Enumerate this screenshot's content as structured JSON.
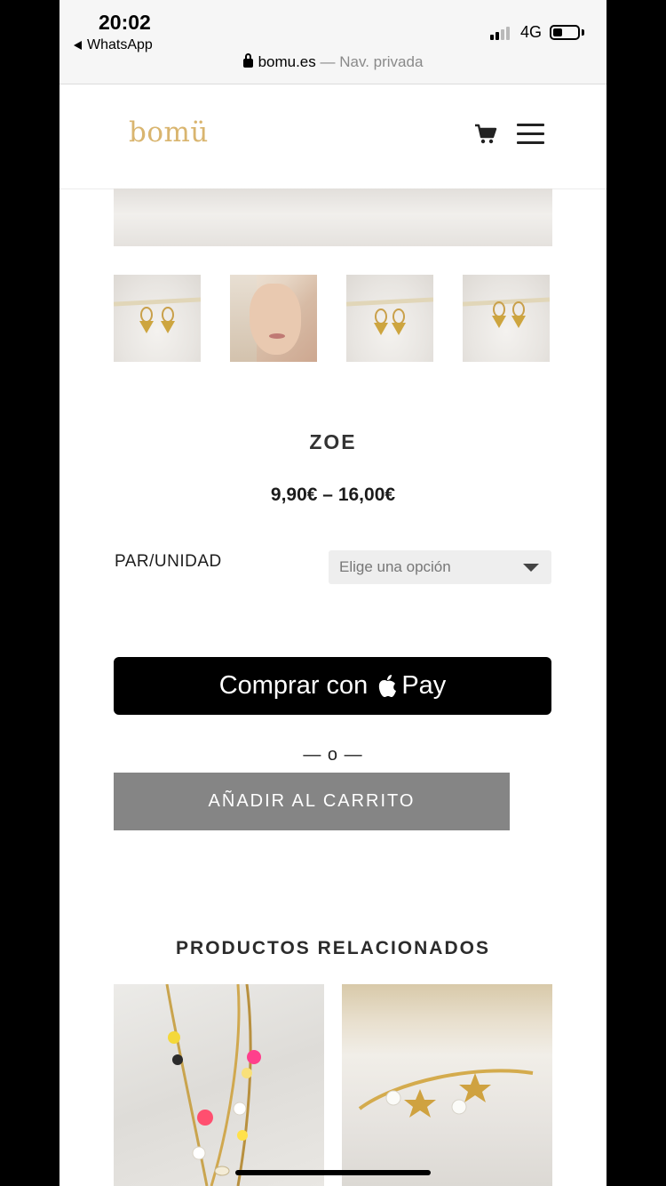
{
  "status_bar": {
    "time": "20:02",
    "back_app": "WhatsApp",
    "network": "4G"
  },
  "browser": {
    "domain": "bomu.es",
    "separator": "—",
    "mode": "Nav. privada"
  },
  "header": {
    "logo": "bomü"
  },
  "product": {
    "title": "ZOE",
    "price": "9,90€ – 16,00€",
    "variant_label": "PAR/UNIDAD",
    "variant_placeholder": "Elige una opción"
  },
  "buttons": {
    "applepay_text": "Comprar con",
    "applepay_brand": "Pay",
    "divider": "— o —",
    "add_to_cart": "AÑADIR AL CARRITO"
  },
  "related": {
    "title": "PRODUCTOS RELACIONADOS"
  },
  "colors": {
    "logo": "#d9b56f",
    "add_to_cart_bg": "#858585",
    "applepay_bg": "#000000"
  }
}
